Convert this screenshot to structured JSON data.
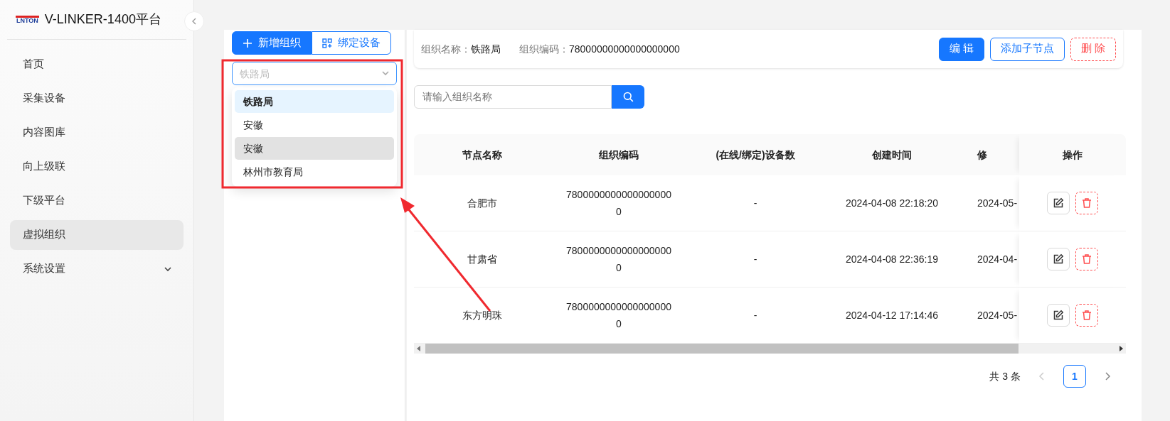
{
  "sidebar": {
    "logo_text": "LNTON",
    "title": "V-LINKER-1400平台",
    "items": [
      {
        "label": "首页",
        "selected": false
      },
      {
        "label": "采集设备",
        "selected": false
      },
      {
        "label": "内容图库",
        "selected": false
      },
      {
        "label": "向上级联",
        "selected": false
      },
      {
        "label": "下级平台",
        "selected": false
      },
      {
        "label": "虚拟组织",
        "selected": true
      },
      {
        "label": "系统设置",
        "selected": false,
        "expanded": false
      }
    ]
  },
  "left_panel": {
    "buttons": [
      {
        "label": "新增组织",
        "kind": "primary"
      },
      {
        "label": "绑定设备",
        "kind": "outline"
      }
    ],
    "select": {
      "placeholder": "铁路局"
    },
    "options": [
      {
        "label": "铁路局",
        "selected": true,
        "hovered": false
      },
      {
        "label": "安徽",
        "selected": false,
        "hovered": false
      },
      {
        "label": "安徽",
        "selected": false,
        "hovered": true
      },
      {
        "label": "林州市教育局",
        "selected": false,
        "hovered": false
      }
    ]
  },
  "info": {
    "fields": [
      {
        "label": "组织名称：",
        "value": "铁路局"
      },
      {
        "label": "组织编码：",
        "value": "78000000000000000000"
      }
    ],
    "buttons": [
      {
        "label": "编 辑",
        "kind": "primary"
      },
      {
        "label": "添加子节点",
        "kind": "outline"
      },
      {
        "label": "删 除",
        "kind": "danger"
      }
    ]
  },
  "search": {
    "placeholder": "请输入组织名称"
  },
  "table": {
    "columns": [
      "节点名称",
      "组织编码",
      "(在线/绑定)设备数",
      "创建时间",
      "修",
      "操作"
    ],
    "rows": [
      [
        "合肥市",
        "78000000000000000000",
        "-",
        "2024-04-08 22:18:20",
        "2024-05-"
      ],
      [
        "甘肃省",
        "78000000000000000000",
        "-",
        "2024-04-08 22:36:19",
        "2024-04-"
      ],
      [
        "东方明珠",
        "78000000000000000000",
        "-",
        "2024-04-12 17:14:46",
        "2024-05-"
      ]
    ]
  },
  "pagination": {
    "total": "共 3 条",
    "pages": [
      {
        "label": "1",
        "selected": true
      }
    ],
    "prev_disabled": true,
    "next_disabled": false
  }
}
